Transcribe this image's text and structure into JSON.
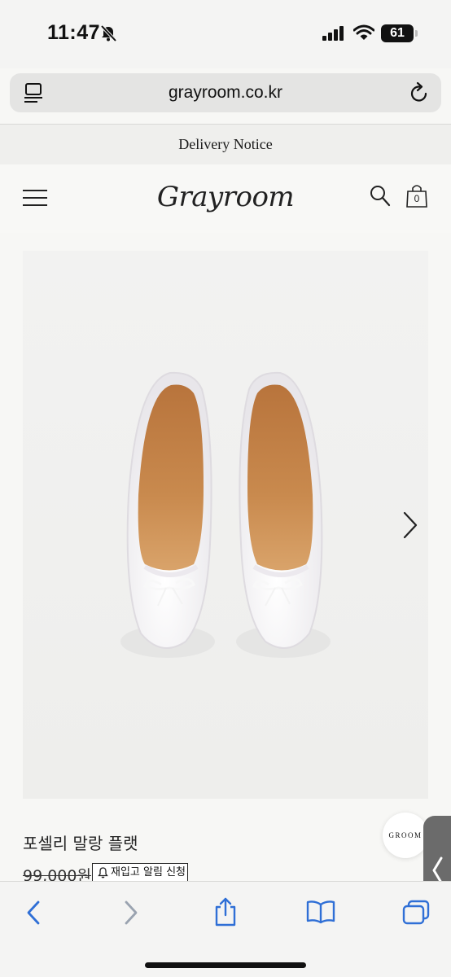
{
  "status": {
    "time": "11:47",
    "battery": "61"
  },
  "browser": {
    "url": "grayroom.co.kr"
  },
  "site": {
    "notice": "Delivery Notice",
    "logo": "Grayroom",
    "cart_count": "0"
  },
  "product": {
    "title": "포셀리 말랑 플랫",
    "price": "99,000원",
    "restock_label": "재입고 알림 신청"
  },
  "floating": {
    "badge": "GROOM"
  },
  "colors": {
    "background": "#f7f7f5",
    "toolbar_icons": "#2f6fd6",
    "disabled_icon": "#9aa3b0"
  },
  "icons": [
    "bell-slash-icon",
    "signal-icon",
    "wifi-icon",
    "reader-icon",
    "reload-icon",
    "menu-icon",
    "search-icon",
    "bag-icon",
    "chevron-right-icon",
    "back-icon",
    "forward-icon",
    "share-icon",
    "bookmarks-icon",
    "tabs-icon"
  ]
}
